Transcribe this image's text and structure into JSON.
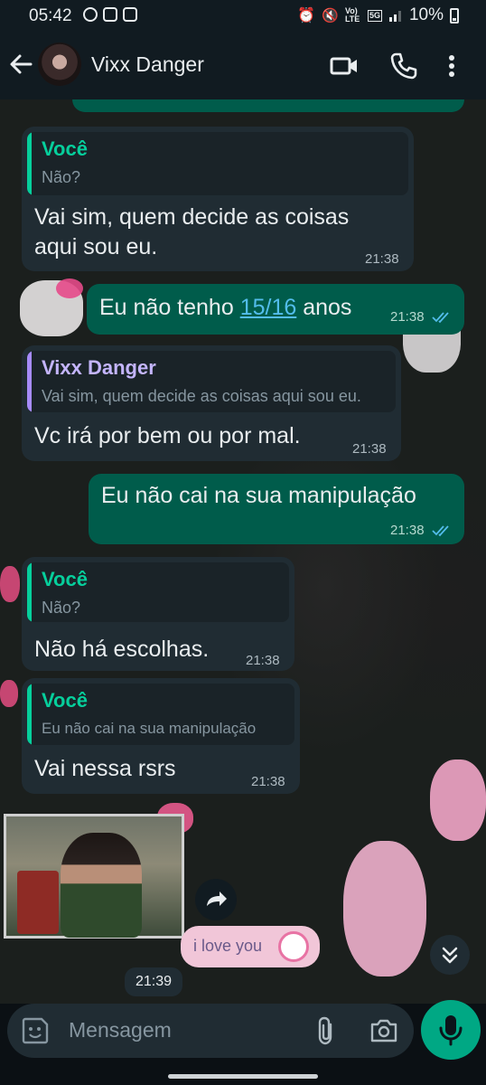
{
  "status": {
    "time": "05:42",
    "network": "5G",
    "volte": "Vo) LTE",
    "battery": "10%"
  },
  "header": {
    "contact_name": "Vixx Danger"
  },
  "messages": [
    {
      "direction": "incoming",
      "quote_author": "Você",
      "quote_text": "Não?",
      "text_line1": "Vai sim, quem decide as coisas",
      "text_line2": "aqui sou eu.",
      "time": "21:38"
    },
    {
      "direction": "outgoing",
      "text_before": "Eu não tenho ",
      "text_link": "15/16",
      "text_after": " anos",
      "time": "21:38"
    },
    {
      "direction": "incoming",
      "quote_author": "Vixx Danger",
      "quote_text": "Vai sim, quem decide as coisas aqui sou eu.",
      "text": "Vc irá por bem ou por mal.",
      "time": "21:38"
    },
    {
      "direction": "outgoing",
      "text": "Eu não cai na sua manipulação",
      "time": "21:38"
    },
    {
      "direction": "incoming",
      "quote_author": "Você",
      "quote_text": "Não?",
      "text": "Não há escolhas.",
      "time": "21:38"
    },
    {
      "direction": "incoming",
      "quote_author": "Você",
      "quote_text": "Eu não cai na sua manipulação",
      "text": "Vai nessa rsrs",
      "time": "21:38"
    }
  ],
  "sticker": {
    "caption": "i love you",
    "time": "21:39"
  },
  "input": {
    "placeholder": "Mensagem"
  },
  "colors": {
    "outgoing_bubble": "#005c4b",
    "incoming_bubble": "#202c33",
    "accent_green": "#00a884",
    "quote_you": "#06cf9c",
    "quote_contact": "#a78bfa",
    "link": "#53bdeb"
  }
}
